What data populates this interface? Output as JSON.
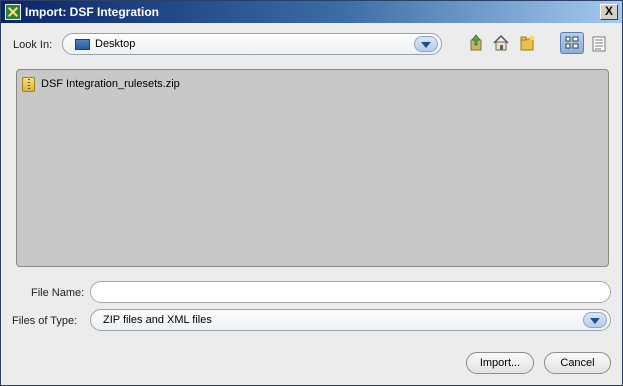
{
  "window": {
    "title": "Import: DSF Integration",
    "close_glyph": "X"
  },
  "look_in": {
    "label": "Look In:",
    "value": "Desktop"
  },
  "toolbar": {
    "icons": [
      "up-folder-icon",
      "home-icon",
      "new-folder-icon",
      "list-view-icon",
      "details-view-icon"
    ]
  },
  "files": [
    {
      "name": "DSF Integration_rulesets.zip",
      "icon": "zip-file-icon"
    }
  ],
  "file_name": {
    "label": "File Name:",
    "value": ""
  },
  "file_type": {
    "label": "Files of Type:",
    "value": "ZIP files and XML files"
  },
  "buttons": {
    "import_label": "Import...",
    "cancel_label": "Cancel"
  },
  "colors": {
    "titlebar_start": "#0a246a",
    "titlebar_end": "#a6caf0",
    "pane_bg": "#c8c8c8",
    "dialog_bg": "#ececec"
  }
}
